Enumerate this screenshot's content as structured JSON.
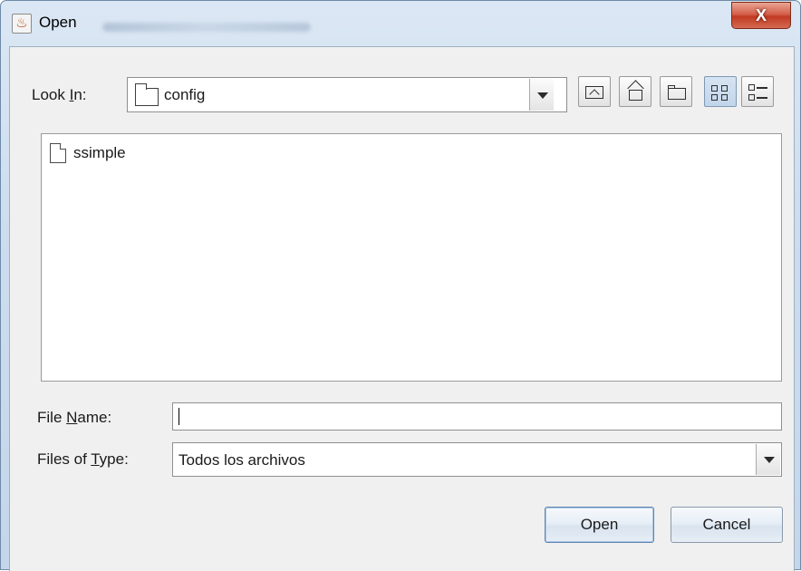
{
  "window": {
    "title": "Open",
    "close_glyph": "X",
    "app_icon": "java-icon"
  },
  "look_in": {
    "label_pre": "Look ",
    "label_mnemonic": "I",
    "label_post": "n:",
    "value": "config",
    "icon": "folder-icon"
  },
  "toolbar": {
    "buttons": [
      {
        "name": "up-one-level",
        "icon": "up-folder-icon"
      },
      {
        "name": "home",
        "icon": "home-icon"
      },
      {
        "name": "create-new-folder",
        "icon": "new-folder-icon"
      },
      {
        "name": "list-view",
        "icon": "list-view-icon",
        "pressed": true
      },
      {
        "name": "details-view",
        "icon": "details-view-icon",
        "pressed": false
      }
    ]
  },
  "files": [
    {
      "name": "ssimple",
      "icon": "file-icon"
    }
  ],
  "file_name": {
    "label_pre": "File ",
    "label_mnemonic": "N",
    "label_post": "ame:",
    "value": ""
  },
  "file_type": {
    "label_pre": "Files of ",
    "label_mnemonic": "T",
    "label_post": "ype:",
    "value": "Todos los archivos"
  },
  "buttons": {
    "open_label": "Open",
    "cancel_label": "Cancel"
  },
  "colors": {
    "title_bar": "#cdddee",
    "close_button": "#c13a22",
    "panel": "#f0f0f0"
  }
}
